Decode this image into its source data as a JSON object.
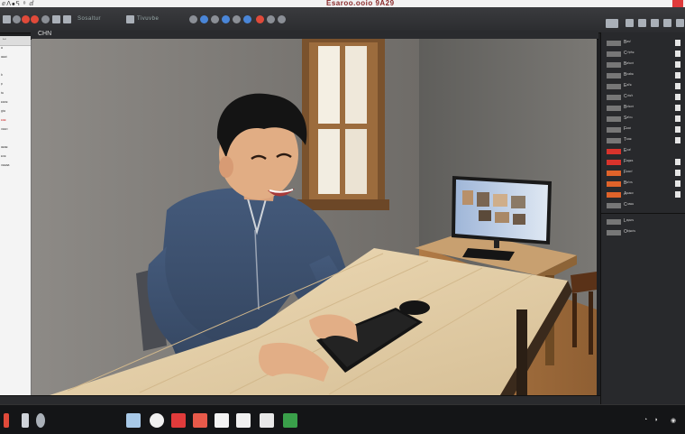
{
  "window": {
    "title": "Esaroo.ooio 9A29",
    "menu_text": "ⅇᐲ⦁ᕋ ᵒ ⅆ"
  },
  "toolbar": {
    "items": [
      "Sosaltur",
      "Tivuvbe"
    ],
    "viewport_tab_label": "CHN"
  },
  "left_panel": {
    "header": "↔",
    "rows": [
      "ᵃ",
      "ᵃᵉᵉᵗ",
      "",
      "ᵇ",
      "ᵖ",
      "ᵗᵉ",
      "ᵉᵃᵒᵉ",
      "ᵍᵗᵃ",
      "ᵉᵃᵉ",
      "ᵒᵉᵉᵒ",
      "",
      "ᵃᵉᵃᵉ",
      "ᵉᵒᵉ",
      "ᵒᵉᵉᵃᵃ"
    ]
  },
  "right_panel": {
    "rows": [
      {
        "label": "Bᵃˢⁱ",
        "swatch": "gray"
      },
      {
        "label": "Cʳⁱᵖⁱᵗᵉ",
        "swatch": "gray"
      },
      {
        "label": "Bᵃⁱᵉᵒᵗ",
        "swatch": "gray"
      },
      {
        "label": "Bᵒᵃᵇᵉ",
        "swatch": "gray"
      },
      {
        "label": "Eᵃˡⁱᵉ",
        "swatch": "gray"
      },
      {
        "label": "Cᵒⁱᵉⁱᵗ",
        "swatch": "gray"
      },
      {
        "label": "Bᵒˡᵉᵒᵗ",
        "swatch": "gray"
      },
      {
        "label": "Sᵃⁱᵒⁿ",
        "swatch": "gray"
      },
      {
        "label": "Fᵉᵃᵗ",
        "swatch": "gray"
      },
      {
        "label": "Tᵉᵃᵉ",
        "swatch": "gray"
      },
      {
        "label": "Eᵒᵃⁱ",
        "swatch": "red"
      },
      {
        "label": "Fᵃᵍᵉˢ",
        "swatch": "red"
      },
      {
        "label": "Fᵉᵃᵒⁱ",
        "swatch": "orange"
      },
      {
        "label": "Bᵉⁱᵒˢ",
        "swatch": "orange"
      },
      {
        "label": "Aᵉᵃᵉᵒ",
        "swatch": "orange"
      },
      {
        "label": "Cᵒᵃᵉᵉ",
        "swatch": "gray"
      }
    ],
    "lower_rows": [
      "Lᵃʸᵉʳˢ",
      "Oᵇʲᵉᶜᵗˢ"
    ]
  },
  "statusbar": {
    "left": "",
    "right": ""
  },
  "scene": {
    "description_colors": {
      "wall": "#7c7975",
      "desk": "#e7d2ad",
      "sweater": "#3c4f6d"
    }
  },
  "taskbar": {
    "apps": [
      "finder-app",
      "photos-app",
      "video-app",
      "docs-app",
      "blank-app-1",
      "blank-app-2",
      "sheets-app"
    ],
    "tray": [
      "wifi-icon",
      "speaker-icon"
    ]
  }
}
